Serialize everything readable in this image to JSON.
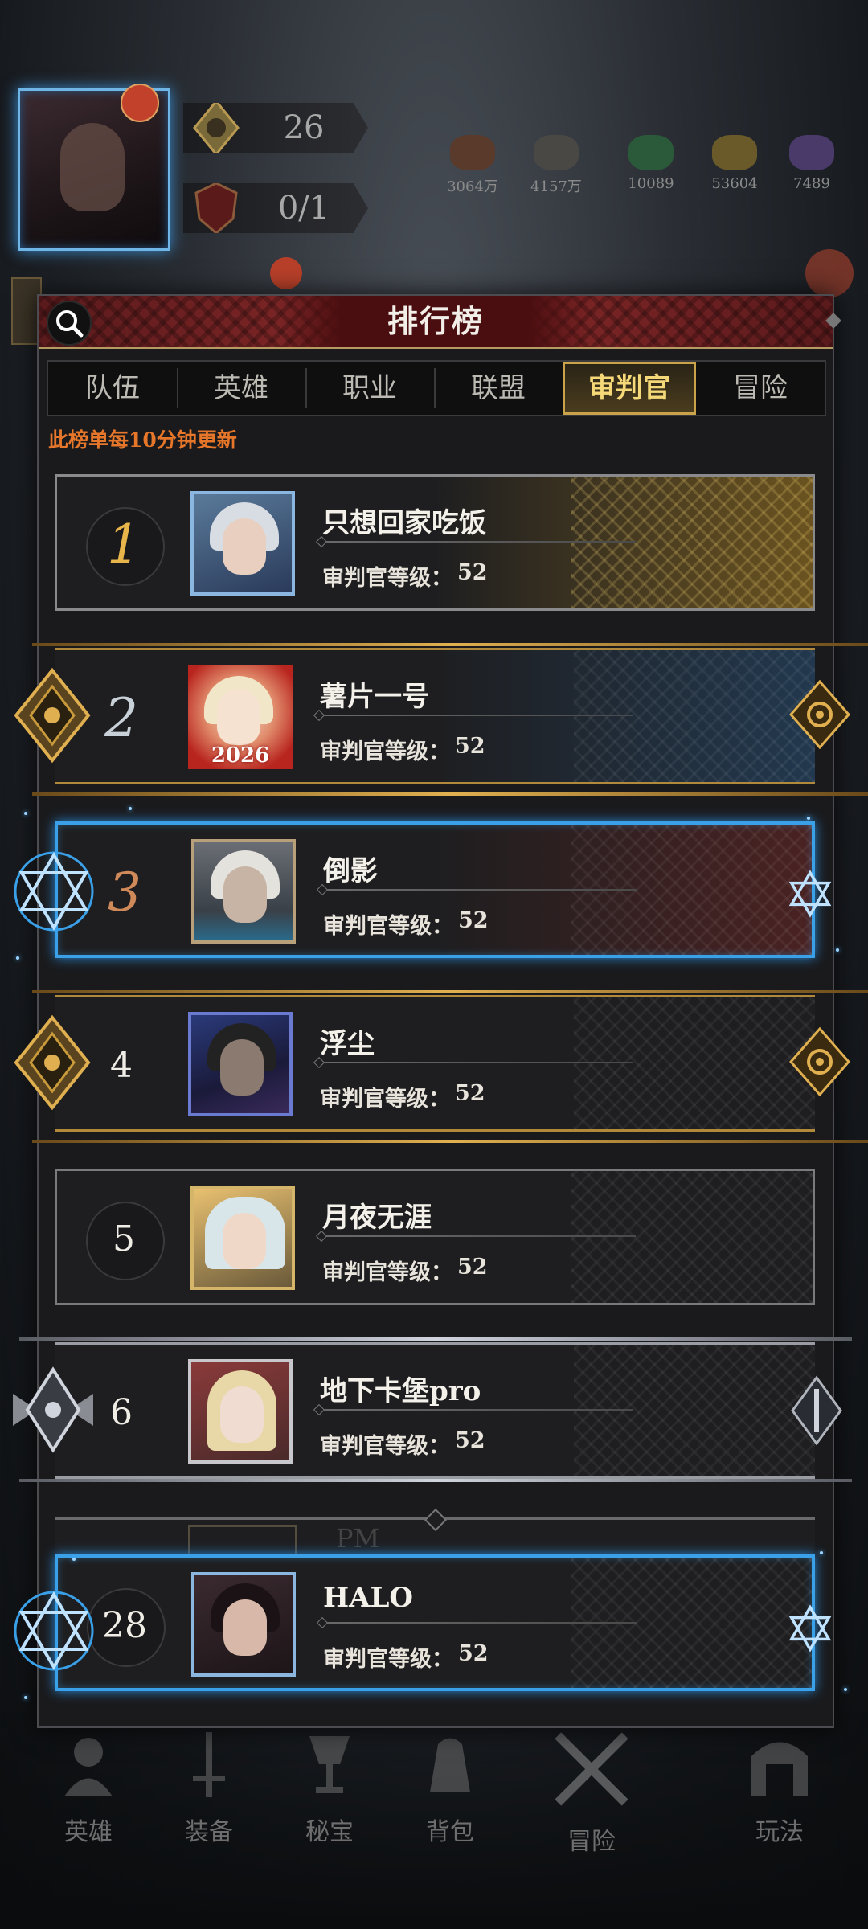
{
  "hud": {
    "level": "26",
    "stamina": "0/1",
    "resources": [
      {
        "icon": "ore-icon",
        "value": "3064万",
        "color": "#5a3a2a"
      },
      {
        "icon": "stone-icon",
        "value": "4157万",
        "color": "#4a4844"
      },
      {
        "icon": "emerald-icon",
        "value": "10089",
        "color": "#2a5a3a"
      },
      {
        "icon": "gold-ore-icon",
        "value": "53604",
        "color": "#6a5a2a"
      },
      {
        "icon": "amethyst-icon",
        "value": "7489",
        "color": "#4a3a6a"
      }
    ]
  },
  "panel": {
    "title": "排行榜",
    "tabs": [
      "队伍",
      "英雄",
      "职业",
      "联盟",
      "审判官",
      "冒险"
    ],
    "active_tab": "审判官",
    "notice": "此榜单每10分钟更新"
  },
  "rankings": [
    {
      "rank": "1",
      "name": "只想回家吃饭",
      "level_label": "审判官等级：",
      "level": "52"
    },
    {
      "rank": "2",
      "name": "薯片一号",
      "level_label": "审判官等级：",
      "level": "52",
      "avatar_tag": "2026"
    },
    {
      "rank": "3",
      "name": "倒影",
      "level_label": "审判官等级：",
      "level": "52"
    },
    {
      "rank": "4",
      "name": "浮尘",
      "level_label": "审判官等级：",
      "level": "52"
    },
    {
      "rank": "5",
      "name": "月夜无涯",
      "level_label": "审判官等级：",
      "level": "52"
    },
    {
      "rank": "6",
      "name": "地下卡堡pro",
      "level_label": "审判官等级：",
      "level": "52"
    }
  ],
  "row7_partial": "PM",
  "my_rank": {
    "rank": "28",
    "name": "HALO",
    "level_label": "审判官等级：",
    "level": "52"
  },
  "bottom_nav": [
    "英雄",
    "装备",
    "秘宝",
    "背包",
    "冒险",
    "玩法"
  ],
  "colors": {
    "accent_gold": "#c9a24a",
    "notice": "#e5762a",
    "frame_blue": "#3aa0e8",
    "title_red": "#8e2a2a"
  }
}
